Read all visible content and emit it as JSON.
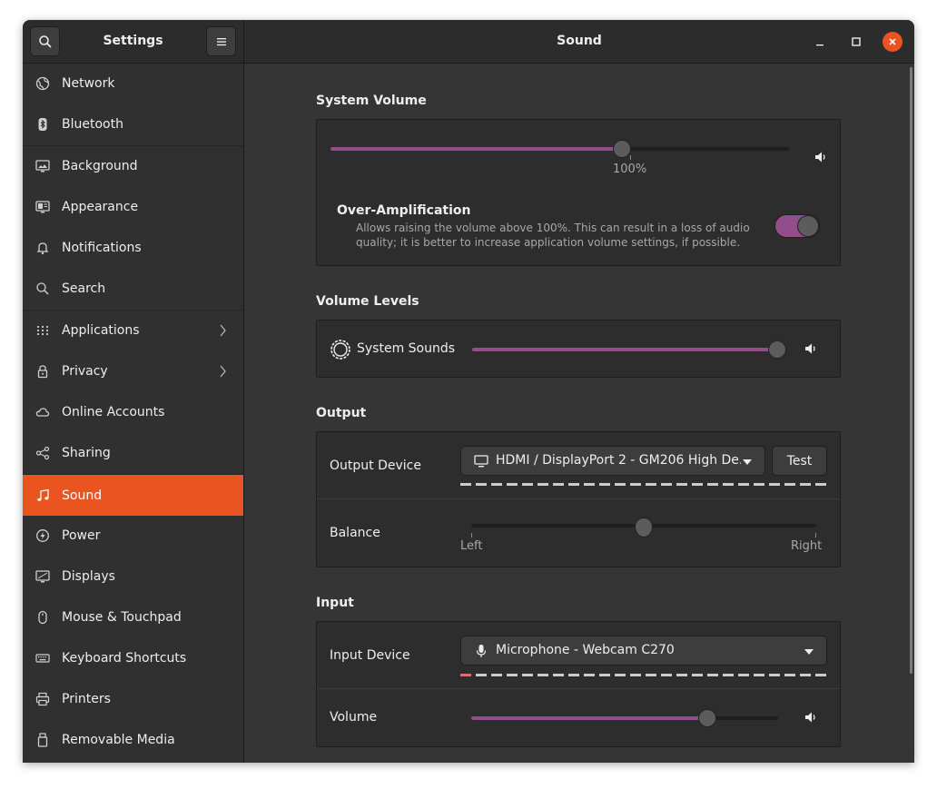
{
  "header": {
    "app_title": "Settings",
    "page_title": "Sound",
    "search_icon": "search-icon",
    "menu_icon": "hamburger-menu-icon",
    "minimize_icon": "minimize-icon",
    "maximize_icon": "maximize-icon",
    "close_icon": "close-icon"
  },
  "sidebar": {
    "items": [
      {
        "label": "Network",
        "icon": "globe-icon"
      },
      {
        "label": "Bluetooth",
        "icon": "bluetooth-icon"
      },
      {
        "label": "Background",
        "icon": "monitor-image-icon"
      },
      {
        "label": "Appearance",
        "icon": "appearance-icon"
      },
      {
        "label": "Notifications",
        "icon": "bell-icon"
      },
      {
        "label": "Search",
        "icon": "search-icon"
      },
      {
        "label": "Applications",
        "icon": "grid-icon"
      },
      {
        "label": "Privacy",
        "icon": "lock-icon"
      },
      {
        "label": "Online Accounts",
        "icon": "cloud-icon"
      },
      {
        "label": "Sharing",
        "icon": "share-icon"
      },
      {
        "label": "Sound",
        "icon": "music-note-icon"
      },
      {
        "label": "Power",
        "icon": "power-icon"
      },
      {
        "label": "Displays",
        "icon": "display-icon"
      },
      {
        "label": "Mouse & Touchpad",
        "icon": "mouse-icon"
      },
      {
        "label": "Keyboard Shortcuts",
        "icon": "keyboard-icon"
      },
      {
        "label": "Printers",
        "icon": "printer-icon"
      },
      {
        "label": "Removable Media",
        "icon": "usb-drive-icon"
      }
    ],
    "active": "Sound"
  },
  "system_volume": {
    "title": "System Volume",
    "value_label": "100%",
    "level": 0.635,
    "over_amp_title": "Over-Amplification",
    "over_amp_desc_line1": "Allows raising the volume above 100%. This can result in a loss of audio",
    "over_amp_desc_line2": "quality; it is better to increase application volume settings, if possible.",
    "over_amp_enabled": true
  },
  "volume_levels": {
    "title": "Volume Levels",
    "system_sounds_label": "System Sounds",
    "system_sounds_level": 1.0
  },
  "output": {
    "title": "Output",
    "device_label": "Output Device",
    "device_value": "HDMI / DisplayPort 2 - GM206 High De...",
    "test_label": "Test",
    "balance_label": "Balance",
    "balance_left": "Left",
    "balance_right": "Right",
    "balance_value": 0.5
  },
  "input": {
    "title": "Input",
    "device_label": "Input Device",
    "device_value": "Microphone - Webcam C270",
    "volume_label": "Volume",
    "volume_level": 0.77
  },
  "colors": {
    "accent": "#e95420",
    "slider_fill": "#924d8b",
    "level_idle": "#cccccc",
    "level_active": "#e06c75"
  }
}
